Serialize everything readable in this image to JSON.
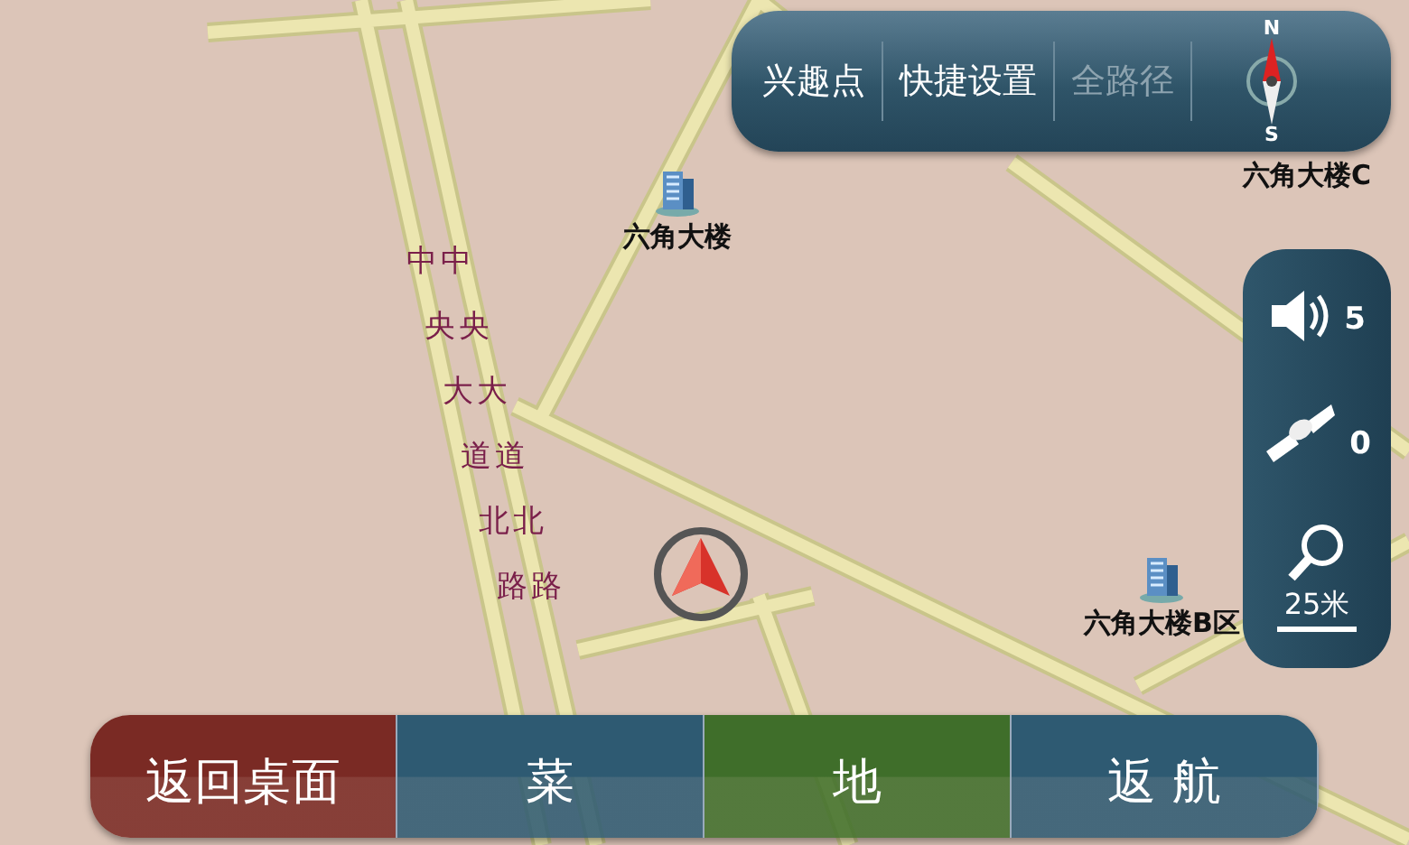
{
  "map": {
    "street_label_lines": [
      "中中",
      "央央",
      "大大",
      "道道",
      "北北",
      "路路"
    ],
    "places": [
      {
        "name": "六角大楼",
        "icon": true
      },
      {
        "name": "六角大楼C",
        "icon": false
      },
      {
        "name": "六角大楼B区",
        "icon": true
      }
    ]
  },
  "top_menu": {
    "items": [
      {
        "label": "兴趣点",
        "disabled": false
      },
      {
        "label": "快捷设置",
        "disabled": false
      },
      {
        "label": "全路径",
        "disabled": true
      }
    ],
    "compass": {
      "north": "N",
      "south": "S"
    }
  },
  "side_panel": {
    "volume": "5",
    "satellites": "0",
    "scale": "25米"
  },
  "bottom_buttons": [
    {
      "label": "返回桌面",
      "color": "#7a2a24"
    },
    {
      "label": "菜",
      "color": "#2e5a72"
    },
    {
      "label": "地",
      "color": "#3f6e2a"
    },
    {
      "label": "返 航",
      "color": "#2e5a72"
    }
  ]
}
